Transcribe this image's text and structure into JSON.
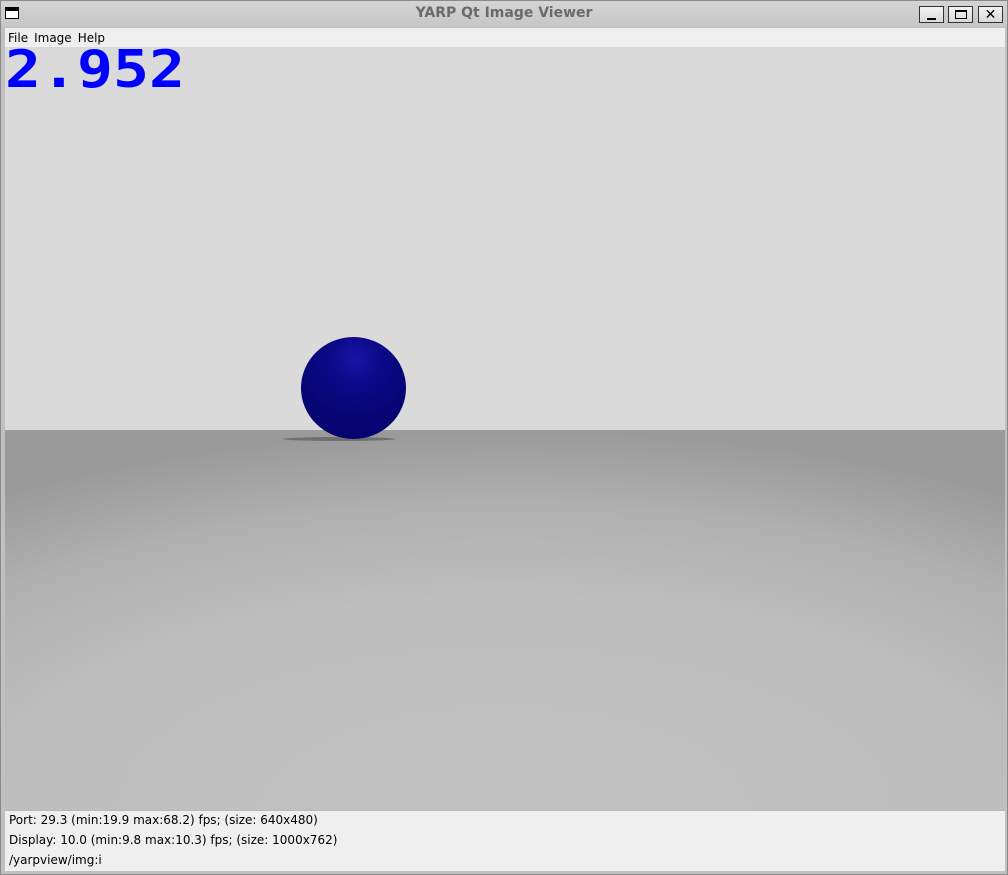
{
  "window": {
    "title": "YARP Qt Image Viewer"
  },
  "menubar": {
    "items": [
      {
        "label": "File"
      },
      {
        "label": "Image"
      },
      {
        "label": "Help"
      }
    ]
  },
  "viewport": {
    "counter_text": "2.952",
    "counter_color": "#0000ff",
    "ball_color": "#07067a",
    "sky_color": "#dadada",
    "floor_color": "#bebebe"
  },
  "status": {
    "port_line": "Port: 29.3 (min:19.9 max:68.2) fps; (size: 640x480)",
    "display_line": "Display: 10.0 (min:9.8 max:10.3) fps; (size: 1000x762)",
    "port_name": "/yarpview/img:i"
  },
  "icons": {
    "window_icon": "window-icon",
    "minimize": "minimize-icon",
    "maximize": "maximize-icon",
    "close": "close-icon"
  }
}
